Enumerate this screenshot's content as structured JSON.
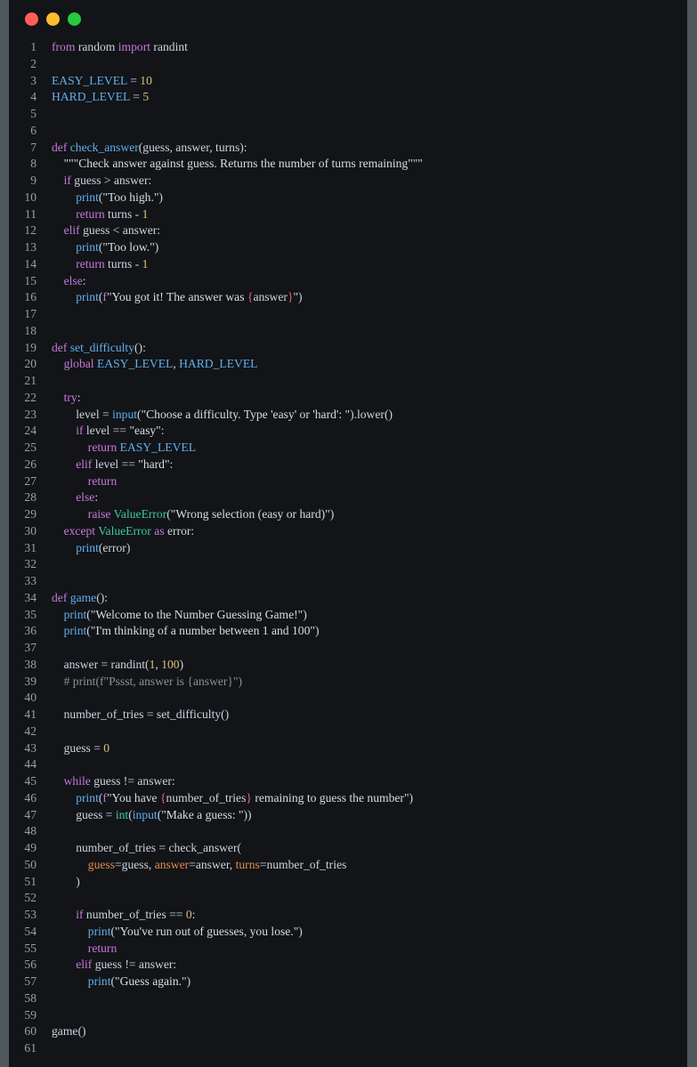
{
  "window": {
    "controls": [
      {
        "name": "close",
        "color": "#ff5f57"
      },
      {
        "name": "minimize",
        "color": "#febc2e"
      },
      {
        "name": "maximize",
        "color": "#28c840"
      }
    ]
  },
  "editor": {
    "language": "python",
    "lines": [
      {
        "n": "1",
        "indent": 0,
        "tokens": [
          [
            "kw",
            "from"
          ],
          [
            "t",
            " random "
          ],
          [
            "kw",
            "import"
          ],
          [
            "t",
            " randint"
          ]
        ]
      },
      {
        "n": "2",
        "indent": 0,
        "tokens": []
      },
      {
        "n": "3",
        "indent": 0,
        "tokens": [
          [
            "cn",
            "EASY_LEVEL"
          ],
          [
            "t",
            " = "
          ],
          [
            "nm",
            "10"
          ]
        ]
      },
      {
        "n": "4",
        "indent": 0,
        "tokens": [
          [
            "cn",
            "HARD_LEVEL"
          ],
          [
            "t",
            " = "
          ],
          [
            "nm",
            "5"
          ]
        ]
      },
      {
        "n": "5",
        "indent": 0,
        "tokens": []
      },
      {
        "n": "6",
        "indent": 0,
        "tokens": []
      },
      {
        "n": "7",
        "indent": 0,
        "tokens": [
          [
            "kw",
            "def"
          ],
          [
            "t",
            " "
          ],
          [
            "fn",
            "check_answer"
          ],
          [
            "t",
            "(guess, answer, turns):"
          ]
        ]
      },
      {
        "n": "8",
        "indent": 1,
        "tokens": [
          [
            "st",
            "\"\"\"Check answer against guess. Returns the number of turns remaining\"\"\""
          ]
        ]
      },
      {
        "n": "9",
        "indent": 1,
        "tokens": [
          [
            "kw",
            "if"
          ],
          [
            "t",
            " guess > answer:"
          ]
        ]
      },
      {
        "n": "10",
        "indent": 2,
        "tokens": [
          [
            "fn",
            "print"
          ],
          [
            "t",
            "("
          ],
          [
            "st",
            "\"Too high.\""
          ],
          [
            "t",
            ")"
          ]
        ]
      },
      {
        "n": "11",
        "indent": 2,
        "tokens": [
          [
            "kw",
            "return"
          ],
          [
            "t",
            " turns - "
          ],
          [
            "nm",
            "1"
          ]
        ]
      },
      {
        "n": "12",
        "indent": 1,
        "tokens": [
          [
            "kw",
            "elif"
          ],
          [
            "t",
            " guess < answer:"
          ]
        ]
      },
      {
        "n": "13",
        "indent": 2,
        "tokens": [
          [
            "fn",
            "print"
          ],
          [
            "t",
            "("
          ],
          [
            "st",
            "\"Too low.\""
          ],
          [
            "t",
            ")"
          ]
        ]
      },
      {
        "n": "14",
        "indent": 2,
        "tokens": [
          [
            "kw",
            "return"
          ],
          [
            "t",
            " turns - "
          ],
          [
            "nm",
            "1"
          ]
        ]
      },
      {
        "n": "15",
        "indent": 1,
        "tokens": [
          [
            "kw",
            "else"
          ],
          [
            "t",
            ":"
          ]
        ]
      },
      {
        "n": "16",
        "indent": 2,
        "tokens": [
          [
            "fn",
            "print"
          ],
          [
            "t",
            "("
          ],
          [
            "kw",
            "f"
          ],
          [
            "st",
            "\"You got it! The answer was "
          ],
          [
            "br",
            "{"
          ],
          [
            "t",
            "answer"
          ],
          [
            "br",
            "}"
          ],
          [
            "st",
            "\""
          ],
          [
            "t",
            ")"
          ]
        ]
      },
      {
        "n": "17",
        "indent": 0,
        "tokens": []
      },
      {
        "n": "18",
        "indent": 0,
        "tokens": []
      },
      {
        "n": "19",
        "indent": 0,
        "tokens": [
          [
            "kw",
            "def"
          ],
          [
            "t",
            " "
          ],
          [
            "fn",
            "set_difficulty"
          ],
          [
            "t",
            "():"
          ]
        ]
      },
      {
        "n": "20",
        "indent": 1,
        "tokens": [
          [
            "kw",
            "global"
          ],
          [
            "t",
            " "
          ],
          [
            "cn",
            "EASY_LEVEL"
          ],
          [
            "t",
            ", "
          ],
          [
            "cn",
            "HARD_LEVEL"
          ]
        ]
      },
      {
        "n": "21",
        "indent": 0,
        "tokens": []
      },
      {
        "n": "22",
        "indent": 1,
        "tokens": [
          [
            "kw",
            "try"
          ],
          [
            "t",
            ":"
          ]
        ]
      },
      {
        "n": "23",
        "indent": 2,
        "tokens": [
          [
            "t",
            "level = "
          ],
          [
            "fn",
            "input"
          ],
          [
            "t",
            "("
          ],
          [
            "st",
            "\"Choose a difficulty. Type 'easy' or 'hard': \""
          ],
          [
            "t",
            ").lower()"
          ]
        ]
      },
      {
        "n": "24",
        "indent": 2,
        "tokens": [
          [
            "kw",
            "if"
          ],
          [
            "t",
            " level == "
          ],
          [
            "st",
            "\"easy\""
          ],
          [
            "t",
            ":"
          ]
        ]
      },
      {
        "n": "25",
        "indent": 3,
        "tokens": [
          [
            "kw",
            "return"
          ],
          [
            "t",
            " "
          ],
          [
            "cn",
            "EASY_LEVEL"
          ]
        ]
      },
      {
        "n": "26",
        "indent": 2,
        "tokens": [
          [
            "kw",
            "elif"
          ],
          [
            "t",
            " level == "
          ],
          [
            "st",
            "\"hard\""
          ],
          [
            "t",
            ":"
          ]
        ]
      },
      {
        "n": "27",
        "indent": 3,
        "tokens": [
          [
            "kw",
            "return"
          ]
        ]
      },
      {
        "n": "28",
        "indent": 2,
        "tokens": [
          [
            "kw",
            "else"
          ],
          [
            "t",
            ":"
          ]
        ]
      },
      {
        "n": "29",
        "indent": 3,
        "tokens": [
          [
            "kw",
            "raise"
          ],
          [
            "t",
            " "
          ],
          [
            "cl",
            "ValueError"
          ],
          [
            "t",
            "("
          ],
          [
            "st",
            "\"Wrong selection (easy or hard)\""
          ],
          [
            "t",
            ")"
          ]
        ]
      },
      {
        "n": "30",
        "indent": 1,
        "tokens": [
          [
            "kw",
            "except"
          ],
          [
            "t",
            " "
          ],
          [
            "cl",
            "ValueError"
          ],
          [
            "t",
            " "
          ],
          [
            "kw",
            "as"
          ],
          [
            "t",
            " error:"
          ]
        ]
      },
      {
        "n": "31",
        "indent": 2,
        "tokens": [
          [
            "fn",
            "print"
          ],
          [
            "t",
            "(error)"
          ]
        ]
      },
      {
        "n": "32",
        "indent": 0,
        "tokens": []
      },
      {
        "n": "33",
        "indent": 0,
        "tokens": []
      },
      {
        "n": "34",
        "indent": 0,
        "tokens": [
          [
            "kw",
            "def"
          ],
          [
            "t",
            " "
          ],
          [
            "fn",
            "game"
          ],
          [
            "t",
            "():"
          ]
        ]
      },
      {
        "n": "35",
        "indent": 1,
        "tokens": [
          [
            "fn",
            "print"
          ],
          [
            "t",
            "("
          ],
          [
            "st",
            "\"Welcome to the Number Guessing Game!\""
          ],
          [
            "t",
            ")"
          ]
        ]
      },
      {
        "n": "36",
        "indent": 1,
        "tokens": [
          [
            "fn",
            "print"
          ],
          [
            "t",
            "("
          ],
          [
            "st",
            "\"I'm thinking of a number between 1 and 100\""
          ],
          [
            "t",
            ")"
          ]
        ]
      },
      {
        "n": "37",
        "indent": 0,
        "tokens": []
      },
      {
        "n": "38",
        "indent": 1,
        "tokens": [
          [
            "t",
            "answer = randint("
          ],
          [
            "nm",
            "1"
          ],
          [
            "t",
            ", "
          ],
          [
            "nm",
            "100"
          ],
          [
            "t",
            ")"
          ]
        ]
      },
      {
        "n": "39",
        "indent": 1,
        "tokens": [
          [
            "cm",
            "# print(f\"Pssst, answer is {answer}\")"
          ]
        ]
      },
      {
        "n": "40",
        "indent": 0,
        "tokens": []
      },
      {
        "n": "41",
        "indent": 1,
        "tokens": [
          [
            "t",
            "number_of_tries = set_difficulty()"
          ]
        ]
      },
      {
        "n": "42",
        "indent": 0,
        "tokens": []
      },
      {
        "n": "43",
        "indent": 1,
        "tokens": [
          [
            "t",
            "guess = "
          ],
          [
            "nm",
            "0"
          ]
        ]
      },
      {
        "n": "44",
        "indent": 0,
        "tokens": []
      },
      {
        "n": "45",
        "indent": 1,
        "tokens": [
          [
            "kw",
            "while"
          ],
          [
            "t",
            " guess != answer:"
          ]
        ]
      },
      {
        "n": "46",
        "indent": 2,
        "tokens": [
          [
            "fn",
            "print"
          ],
          [
            "t",
            "("
          ],
          [
            "kw",
            "f"
          ],
          [
            "st",
            "\"You have "
          ],
          [
            "br",
            "{"
          ],
          [
            "t",
            "number_of_tries"
          ],
          [
            "br",
            "}"
          ],
          [
            "st",
            " remaining to guess the number\""
          ],
          [
            "t",
            ")"
          ]
        ]
      },
      {
        "n": "47",
        "indent": 2,
        "tokens": [
          [
            "t",
            "guess = "
          ],
          [
            "cl",
            "int"
          ],
          [
            "t",
            "("
          ],
          [
            "fn",
            "input"
          ],
          [
            "t",
            "("
          ],
          [
            "st",
            "\"Make a guess: \""
          ],
          [
            "t",
            "))"
          ]
        ]
      },
      {
        "n": "48",
        "indent": 0,
        "tokens": []
      },
      {
        "n": "49",
        "indent": 2,
        "tokens": [
          [
            "t",
            "number_of_tries = check_answer("
          ]
        ]
      },
      {
        "n": "50",
        "indent": 3,
        "tokens": [
          [
            "pa",
            "guess"
          ],
          [
            "t",
            "=guess, "
          ],
          [
            "pa",
            "answer"
          ],
          [
            "t",
            "=answer, "
          ],
          [
            "pa",
            "turns"
          ],
          [
            "t",
            "=number_of_tries"
          ]
        ]
      },
      {
        "n": "51",
        "indent": 2,
        "tokens": [
          [
            "t",
            ")"
          ]
        ]
      },
      {
        "n": "52",
        "indent": 0,
        "tokens": []
      },
      {
        "n": "53",
        "indent": 2,
        "tokens": [
          [
            "kw",
            "if"
          ],
          [
            "t",
            " number_of_tries == "
          ],
          [
            "nm",
            "0"
          ],
          [
            "t",
            ":"
          ]
        ]
      },
      {
        "n": "54",
        "indent": 3,
        "tokens": [
          [
            "fn",
            "print"
          ],
          [
            "t",
            "("
          ],
          [
            "st",
            "\"You've run out of guesses, you lose.\""
          ],
          [
            "t",
            ")"
          ]
        ]
      },
      {
        "n": "55",
        "indent": 3,
        "tokens": [
          [
            "kw",
            "return"
          ]
        ]
      },
      {
        "n": "56",
        "indent": 2,
        "tokens": [
          [
            "kw",
            "elif"
          ],
          [
            "t",
            " guess != answer:"
          ]
        ]
      },
      {
        "n": "57",
        "indent": 3,
        "tokens": [
          [
            "fn",
            "print"
          ],
          [
            "t",
            "("
          ],
          [
            "st",
            "\"Guess again.\""
          ],
          [
            "t",
            ")"
          ]
        ]
      },
      {
        "n": "58",
        "indent": 0,
        "tokens": []
      },
      {
        "n": "59",
        "indent": 0,
        "tokens": []
      },
      {
        "n": "60",
        "indent": 0,
        "tokens": [
          [
            "t",
            "game()"
          ]
        ]
      },
      {
        "n": "61",
        "indent": 0,
        "tokens": []
      }
    ]
  }
}
